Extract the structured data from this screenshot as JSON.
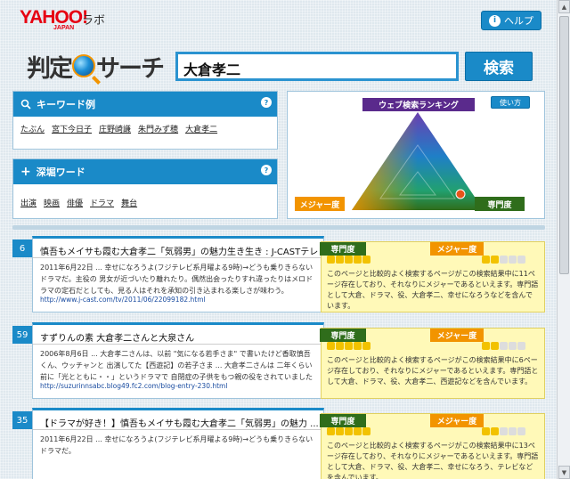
{
  "header": {
    "logo": "YAHOO!",
    "logo_sub": "JAPAN",
    "labo": "ラボ",
    "help": "ヘルプ"
  },
  "brand": {
    "part1": "判定",
    "part2": "サーチ"
  },
  "search": {
    "value": "大倉孝二",
    "button": "検索"
  },
  "keyword_panel": {
    "title": "キーワード例",
    "items": [
      "たぶん",
      "宮下今日子",
      "庄野崎謙",
      "朱門みず穂",
      "大倉孝二"
    ]
  },
  "dig_panel": {
    "title": "深堀ワード",
    "items": [
      "出演",
      "映画",
      "俳優",
      "ドラマ",
      "舞台"
    ]
  },
  "ranking": {
    "title": "ウェブ検索ランキング",
    "howto": "使い方",
    "major_label": "メジャー度",
    "specialty_label": "専門度"
  },
  "results": [
    {
      "rank": "6",
      "title": "慎吾もメイサも霞む大倉孝二「気弱男」の魅力生き生き : J-CASTテレビ ...",
      "snippet": "2011年6月22日 ... 幸せになろうよ(フジテレビ系月曜よる9時)→どうも乗りきらないドラマだ。主役の 男女が近づいたり離れたり。偶然出会ったりすれ違ったりはメロドラマの定石だとしても、見る人はそれを承知の引き込まれる楽しさが味わう。",
      "url": "http://www.j-cast.com/tv/2011/06/22099182.html",
      "specialty_stars": 5,
      "major_stars": 2,
      "info": "このページと比較的よく検索するページがこの検索結果中に11ページ存在しており、それなりにメジャーであるといえます。専門語として大倉、ドラマ、役、大倉孝二、幸せになろうなどを含んでいます。"
    },
    {
      "rank": "59",
      "title": "すずりんの素 大倉孝二さんと大泉さん",
      "snippet": "2006年8月6日 ... 大倉孝二さんは、以前 \"気になる若手さま\" で書いたけど香取慎吾くん、ウッチャンと 出演してた【西遊記】の若子さま ... 大倉孝二さんは 二年くらい前に「光とともに・・」というドラマで 自閉症の子供をもつ親の役をされていました ...",
      "url": "http://suzurinnsabc.blog49.fc2.com/blog-entry-230.html",
      "specialty_stars": 5,
      "major_stars": 2,
      "info": "このページと比較的よく検索するページがこの検索結果中に6ページ存在しており、それなりにメジャーであるといえます。専門語として大倉、ドラマ、役、大倉孝二、西遊記などを含んでいます。"
    },
    {
      "rank": "35",
      "title": "【ドラマが好き！】慎吾もメイサも霞む大倉孝二「気弱男」の魅力 ...",
      "snippet": "2011年6月22日 ... 幸せになろうよ(フジテレビ系月曜よる9時)→どうも乗りきらないドラマだ。",
      "url": "",
      "specialty_stars": 5,
      "major_stars": 2,
      "info": "このページと比較的よく検索するページがこの検索結果中に13ページ存在しており、それなりにメジャーであるといえます。専門語として大倉、ドラマ、役、大倉孝二、幸せになろう、テレビなどを含んでいます。"
    }
  ],
  "colors": {
    "accent": "#1a8ac8",
    "major": "#f29400",
    "specialty": "#2f6d1b",
    "info_bg": "#fff9b8"
  }
}
